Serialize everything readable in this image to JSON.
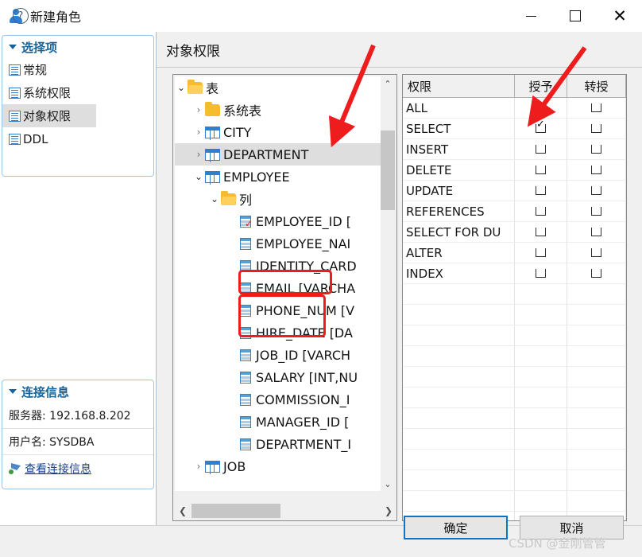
{
  "window": {
    "title": "新建角色",
    "icon": "user-icon",
    "controls": {
      "minimize": "–",
      "maximize": "□",
      "close": "✕"
    }
  },
  "sidebar": {
    "options_group": {
      "label": "选择项"
    },
    "items": [
      {
        "label": "常规",
        "icon": "page-icon",
        "selected": false
      },
      {
        "label": "系统权限",
        "icon": "page-icon",
        "selected": false
      },
      {
        "label": "对象权限",
        "icon": "page-icon",
        "selected": true
      },
      {
        "label": "DDL",
        "icon": "page-icon",
        "selected": false
      }
    ],
    "connection_group": {
      "label": "连接信息"
    },
    "connection": {
      "server": "服务器: 192.168.8.202",
      "user": "用户名: SYSDBA",
      "link": "查看连接信息"
    }
  },
  "main": {
    "title": "对象权限"
  },
  "tree": {
    "nodes": [
      {
        "label": "表",
        "icon": "folder-open-icon",
        "chevron": "⌄",
        "indent": 0,
        "selected": false
      },
      {
        "label": "系统表",
        "icon": "folder-icon",
        "chevron": "›",
        "indent": 1,
        "selected": false
      },
      {
        "label": "CITY",
        "icon": "table-icon",
        "chevron": "›",
        "indent": 1,
        "selected": false
      },
      {
        "label": "DEPARTMENT",
        "icon": "table-icon",
        "chevron": "›",
        "indent": 1,
        "selected": true
      },
      {
        "label": "EMPLOYEE",
        "icon": "table-icon",
        "chevron": "⌄",
        "indent": 1,
        "selected": false
      },
      {
        "label": "列",
        "icon": "folder-open-icon",
        "chevron": "⌄",
        "indent": 2,
        "selected": false
      },
      {
        "label": "EMPLOYEE_ID [",
        "icon": "column-pk-icon",
        "chevron": "",
        "indent": 3,
        "selected": false
      },
      {
        "label": "EMPLOYEE_NAI",
        "icon": "column-icon",
        "chevron": "",
        "indent": 3,
        "selected": false
      },
      {
        "label": "IDENTITY_CARD",
        "icon": "column-icon",
        "chevron": "",
        "indent": 3,
        "selected": false
      },
      {
        "label": "EMAIL [VARCHA",
        "icon": "column-icon",
        "chevron": "",
        "indent": 3,
        "selected": false
      },
      {
        "label": "PHONE_NUM [V",
        "icon": "column-icon",
        "chevron": "",
        "indent": 3,
        "selected": false
      },
      {
        "label": "HIRE_DATE [DA",
        "icon": "column-icon",
        "chevron": "",
        "indent": 3,
        "selected": false
      },
      {
        "label": "JOB_ID [VARCH",
        "icon": "column-icon",
        "chevron": "",
        "indent": 3,
        "selected": false
      },
      {
        "label": "SALARY [INT,NU",
        "icon": "column-icon",
        "chevron": "",
        "indent": 3,
        "selected": false
      },
      {
        "label": "COMMISSION_I",
        "icon": "column-icon",
        "chevron": "",
        "indent": 3,
        "selected": false
      },
      {
        "label": "MANAGER_ID [",
        "icon": "column-icon",
        "chevron": "",
        "indent": 3,
        "selected": false
      },
      {
        "label": "DEPARTMENT_I",
        "icon": "column-icon",
        "chevron": "",
        "indent": 3,
        "selected": false
      },
      {
        "label": "JOB",
        "icon": "table-icon",
        "chevron": "›",
        "indent": 1,
        "selected": false
      }
    ],
    "scroll": {
      "up_arrow": "⌃",
      "down_arrow": "⌄",
      "left_arrow": "❮",
      "right_arrow": "❯"
    }
  },
  "permissions": {
    "headers": [
      "权限",
      "授予",
      "转授"
    ],
    "rows": [
      {
        "name": "ALL",
        "grant": false,
        "transfer": false
      },
      {
        "name": "SELECT",
        "grant": true,
        "transfer": false
      },
      {
        "name": "INSERT",
        "grant": false,
        "transfer": false
      },
      {
        "name": "DELETE",
        "grant": false,
        "transfer": false
      },
      {
        "name": "UPDATE",
        "grant": false,
        "transfer": false
      },
      {
        "name": "REFERENCES",
        "grant": false,
        "transfer": false
      },
      {
        "name": "SELECT FOR DU",
        "grant": false,
        "transfer": false
      },
      {
        "name": "ALTER",
        "grant": false,
        "transfer": false
      },
      {
        "name": "INDEX",
        "grant": false,
        "transfer": false
      }
    ],
    "empty_row_count": 12
  },
  "footer": {
    "help": "?",
    "ok": "确定",
    "cancel": "取消"
  },
  "watermark": "CSDN @金刚管管",
  "colors": {
    "accent": "#16649c",
    "annotation_red": "#ee1c1c",
    "selection_gray": "#dedede",
    "ok_button_border": "#0d74c8"
  }
}
